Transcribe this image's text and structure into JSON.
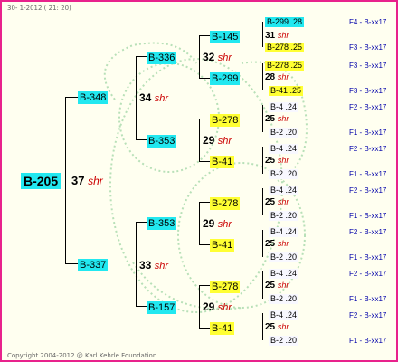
{
  "header": "30-  1-2012 ( 21: 20)",
  "footer": "Copyright 2004-2012 @ Karl Kehrle Foundation.",
  "root": "B-205",
  "root_num": "37",
  "shr": "shr",
  "gen1": {
    "top": "B-348",
    "bottom": "B-337",
    "top_num": "34",
    "bottom_num": "33"
  },
  "gen2": [
    "B-336",
    "B-353",
    "B-353",
    "B-157"
  ],
  "gen2_nums": [
    "32",
    "29",
    "29",
    "29"
  ],
  "gen3": [
    "B-145",
    "B-299",
    "B-278",
    "B-41",
    "B-278",
    "B-41",
    "B-278",
    "B-41"
  ],
  "gen3_nums": [
    "31",
    "28",
    "25",
    "25",
    "25",
    "25",
    "25",
    "25"
  ],
  "gen4": [
    "B-299 .28",
    "B-278 .25",
    "B-278 .25",
    "B-41 .25",
    "B-4 .24",
    "B-2 .20",
    "B-4 .24",
    "B-2 .20",
    "B-4 .24",
    "B-2 .20",
    "B-4 .24",
    "B-2 .20",
    "B-4 .24",
    "B-2 .20",
    "B-4 .24",
    "B-2 .20"
  ],
  "codes": [
    "F4 - B-xx17",
    "F3 - B-xx17",
    "F3 - B-xx17",
    "F3 - B-xx17",
    "F2 - B-xx17",
    "F1 - B-xx17",
    "F2 - B-xx17",
    "F1 - B-xx17",
    "F2 - B-xx17",
    "F1 - B-xx17",
    "F2 - B-xx17",
    "F1 - B-xx17",
    "F2 - B-xx17",
    "F1 - B-xx17",
    "F2 - B-xx17",
    "F1 - B-xx17"
  ],
  "colors": {
    "cyan": "#22e8f0",
    "yellow": "#ffff33",
    "border": "#e8228c",
    "shr": "#cc0000",
    "code": "#0000aa"
  }
}
